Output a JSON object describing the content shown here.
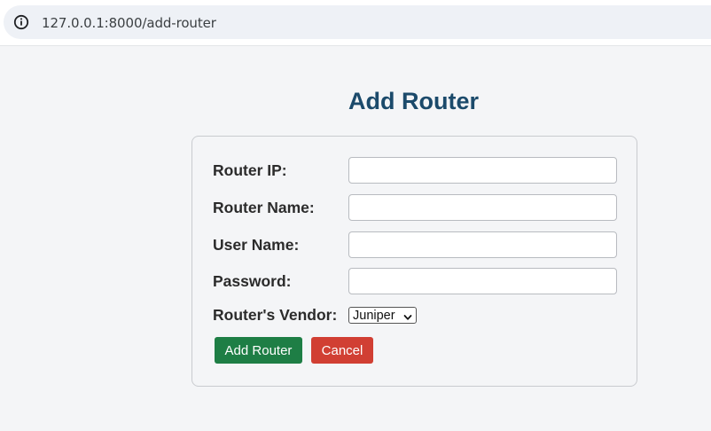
{
  "browser": {
    "url": "127.0.0.1:8000/add-router"
  },
  "page": {
    "title": "Add Router"
  },
  "form": {
    "router_ip_label": "Router IP:",
    "router_ip_value": "",
    "router_name_label": "Router Name:",
    "router_name_value": "",
    "user_name_label": "User Name:",
    "user_name_value": "",
    "password_label": "Password:",
    "password_value": "",
    "vendor_label": "Router's Vendor:",
    "vendor_selected": "Juniper",
    "add_button_label": "Add Router",
    "cancel_button_label": "Cancel"
  },
  "colors": {
    "title": "#1b4a6b",
    "add_button": "#1e7e45",
    "cancel_button": "#d13f33"
  },
  "icons": {
    "address_bar": "info-icon",
    "select": "chevron-down-icon"
  }
}
